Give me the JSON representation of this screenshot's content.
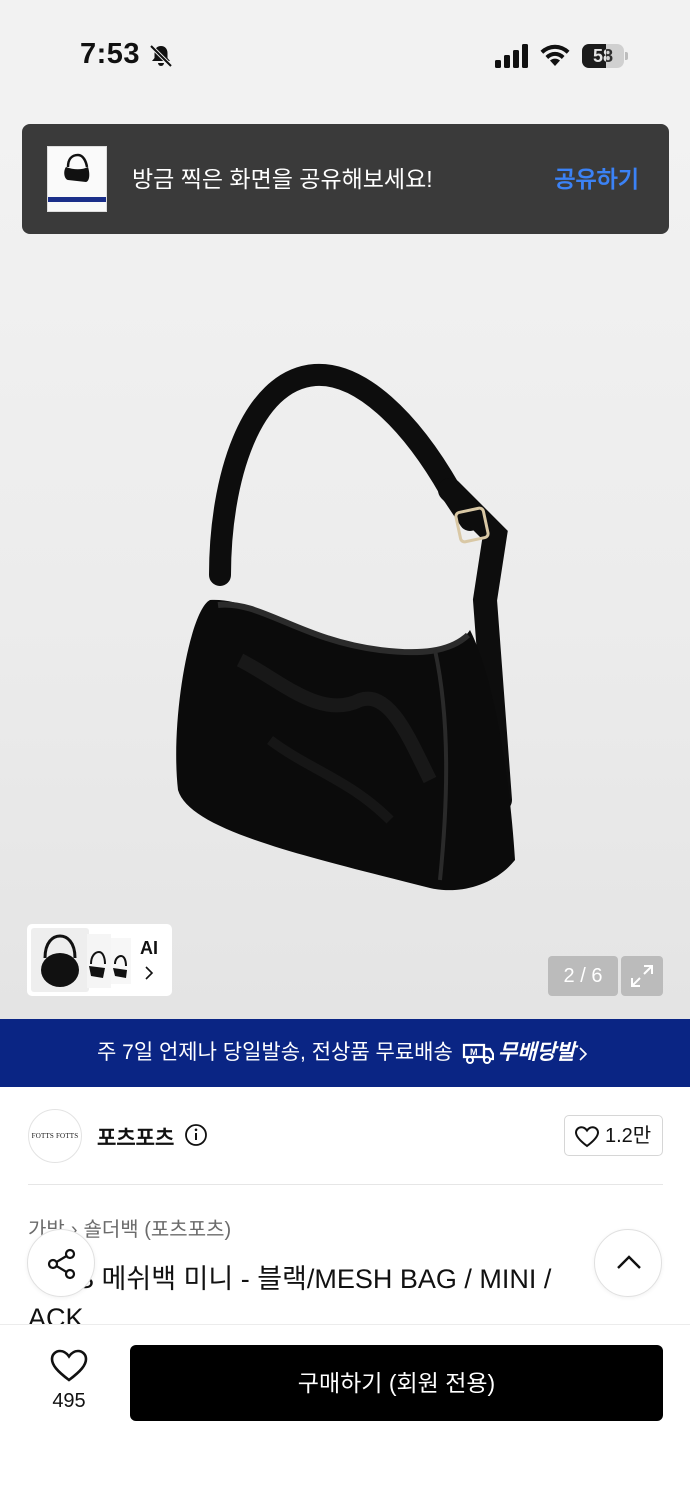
{
  "status_bar": {
    "time": "7:53",
    "battery_level": "58",
    "icons": [
      "bell-slash-icon",
      "signal-icon",
      "wifi-icon",
      "battery-icon"
    ]
  },
  "toast": {
    "message": "방금 찍은 화면을 공유해보세요!",
    "action": "공유하기",
    "action_color": "#3b82f6"
  },
  "gallery": {
    "ai_label": "AI",
    "page_counter": "2 / 6",
    "icons": [
      "chevron-right-icon",
      "expand-icon"
    ]
  },
  "shipping_banner": {
    "text": "주 7일 언제나 당일발송, 전상품 무료배송",
    "logo_text": "무배당발",
    "background": "#0a2584"
  },
  "brand": {
    "logo_text": "FOTTS FOTTS",
    "name": "포츠포츠",
    "like_count": "1.2만"
  },
  "product": {
    "breadcrumb": [
      "가방",
      "숄더백 (포츠포츠)"
    ],
    "title_line1": "S 메쉬백 미니 - 블랙/MESH BAG / MINI /",
    "title_line2": "ACK"
  },
  "bottom_bar": {
    "wish_count": "495",
    "buy_label": "구매하기 (회원 전용)"
  }
}
